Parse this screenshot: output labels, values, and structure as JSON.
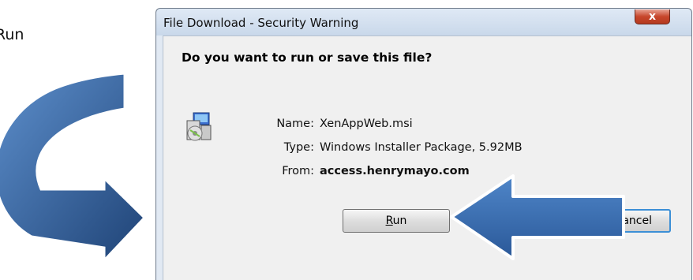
{
  "instruction": {
    "text": "Run"
  },
  "dialog": {
    "title": "File Download - Security Warning",
    "close_label": "x",
    "question": "Do you want to run or save this file?",
    "fields": [
      {
        "label": "Name:",
        "value": "XenAppWeb.msi"
      },
      {
        "label": "Type:",
        "value": "Windows Installer Package, 5.92MB"
      },
      {
        "label": "From:",
        "value": "access.henrymayo.com"
      }
    ],
    "buttons": {
      "run_access_key": "R",
      "run_rest": "un",
      "cancel_visible": "ancel"
    }
  },
  "colors": {
    "arrow_fill": "#3a6fb0",
    "arrow_dark": "#1f4376",
    "dialog_frame": "#e1e9f3",
    "panel": "#f0f0f0"
  },
  "icons": {
    "curved_arrow": "curved-down-right-arrow-icon",
    "callout_arrow": "left-pointing-arrow-icon",
    "installer": "msi-installer-icon",
    "close": "close-icon"
  }
}
